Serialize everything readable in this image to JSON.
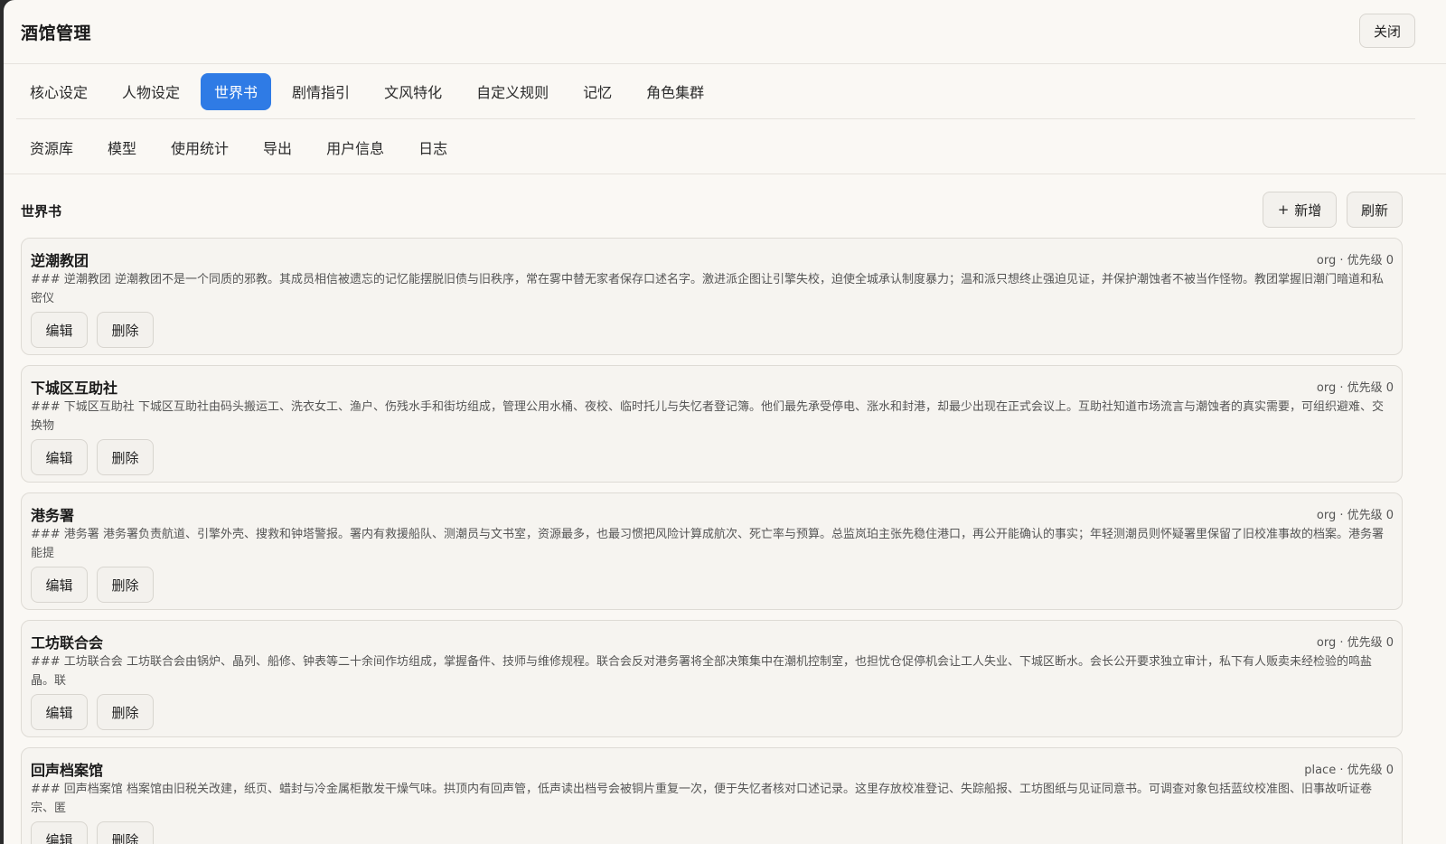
{
  "app": {
    "title": "酒馆管理",
    "close_label": "关闭"
  },
  "tabs_primary": [
    {
      "label": "核心设定",
      "active": false
    },
    {
      "label": "人物设定",
      "active": false
    },
    {
      "label": "世界书",
      "active": true
    },
    {
      "label": "剧情指引",
      "active": false
    },
    {
      "label": "文风特化",
      "active": false
    },
    {
      "label": "自定义规则",
      "active": false
    },
    {
      "label": "记忆",
      "active": false
    },
    {
      "label": "角色集群",
      "active": false
    }
  ],
  "tabs_secondary": [
    {
      "label": "资源库"
    },
    {
      "label": "模型"
    },
    {
      "label": "使用统计"
    },
    {
      "label": "导出"
    },
    {
      "label": "用户信息"
    },
    {
      "label": "日志"
    }
  ],
  "section": {
    "title": "世界书",
    "add_icon": "+",
    "add_label": "新增",
    "refresh_label": "刷新"
  },
  "entries": [
    {
      "name": "逆潮教团",
      "meta": "org · 优先级 0",
      "body": "### 逆潮教团 逆潮教团不是一个同质的邪教。其成员相信被遗忘的记忆能摆脱旧债与旧秩序，常在雾中替无家者保存口述名字。激进派企图让引擎失校，迫使全城承认制度暴力；温和派只想终止强迫见证，并保护潮蚀者不被当作怪物。教团掌握旧潮门暗道和私密仪",
      "edit_label": "编辑",
      "delete_label": "删除"
    },
    {
      "name": "下城区互助社",
      "meta": "org · 优先级 0",
      "body": "### 下城区互助社 下城区互助社由码头搬运工、洗衣女工、渔户、伤残水手和街坊组成，管理公用水桶、夜校、临时托儿与失忆者登记簿。他们最先承受停电、涨水和封港，却最少出现在正式会议上。互助社知道市场流言与潮蚀者的真实需要，可组织避难、交换物",
      "edit_label": "编辑",
      "delete_label": "删除"
    },
    {
      "name": "港务署",
      "meta": "org · 优先级 0",
      "body": "### 港务署 港务署负责航道、引擎外壳、搜救和钟塔警报。署内有救援船队、测潮员与文书室，资源最多，也最习惯把风险计算成航次、死亡率与预算。总监岚珀主张先稳住港口，再公开能确认的事实；年轻测潮员则怀疑署里保留了旧校准事故的档案。港务署能提",
      "edit_label": "编辑",
      "delete_label": "删除"
    },
    {
      "name": "工坊联合会",
      "meta": "org · 优先级 0",
      "body": "### 工坊联合会 工坊联合会由锅炉、晶列、船修、钟表等二十余间作坊组成，掌握备件、技师与维修规程。联合会反对港务署将全部决策集中在潮机控制室，也担忧仓促停机会让工人失业、下城区断水。会长公开要求独立审计，私下有人贩卖未经检验的鸣盐晶。联",
      "edit_label": "编辑",
      "delete_label": "删除"
    },
    {
      "name": "回声档案馆",
      "meta": "place · 优先级 0",
      "body": "### 回声档案馆 档案馆由旧税关改建，纸页、蜡封与冷金属柜散发干燥气味。拱顶内有回声管，低声读出档号会被铜片重复一次，便于失忆者核对口述记录。这里存放校准登记、失踪船报、工坊图纸与见证同意书。可调查对象包括蓝纹校准图、旧事故听证卷宗、匿",
      "edit_label": "编辑",
      "delete_label": "删除"
    }
  ]
}
